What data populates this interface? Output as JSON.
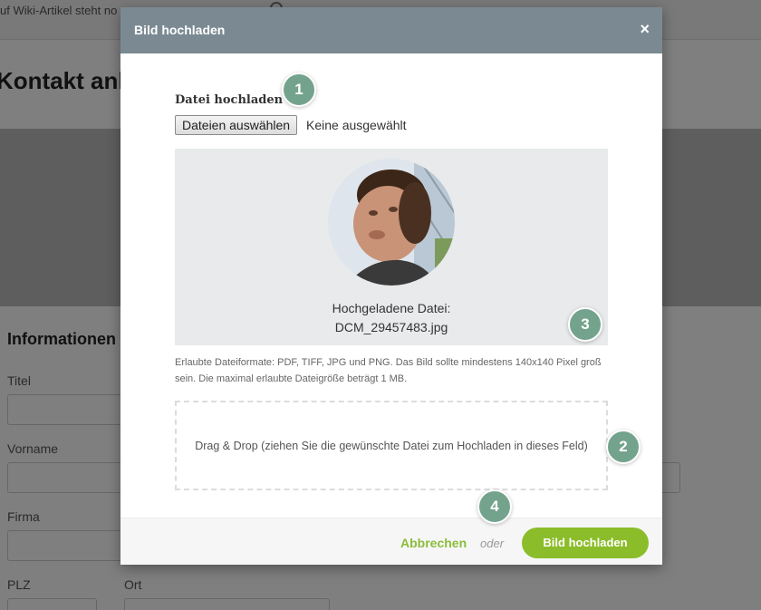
{
  "background": {
    "search_text": "uf Wiki-Artikel steht no",
    "heading": "Kontakt anle",
    "section_title": "Informationen",
    "labels": {
      "title": "Titel",
      "first_name": "Vorname",
      "company": "Firma",
      "zip": "PLZ",
      "city": "Ort"
    }
  },
  "modal": {
    "title": "Bild hochladen",
    "close_icon": "×",
    "field_label": "Datei hochladen",
    "file_button": "Dateien auswählen",
    "file_status": "Keine ausgewählt",
    "preview_caption": "Hochgeladene Datei:",
    "preview_filename": "DCM_29457483.jpg",
    "hint": "Erlaubte Dateiformate: PDF, TIFF, JPG und PNG. Das Bild sollte mindestens 140x140 Pixel groß sein. Die maximal erlaubte Dateigröße beträgt 1 MB.",
    "dropzone_text": "Drag & Drop (ziehen Sie die gewünschte Datei zum Hochladen in dieses Feld)",
    "cancel": "Abbrechen",
    "or": "oder",
    "submit": "Bild hochladen"
  },
  "badges": [
    "1",
    "2",
    "3",
    "4"
  ],
  "colors": {
    "header": "#7b8a92",
    "accent": "#8bbd2a",
    "badge": "#74a38d"
  }
}
